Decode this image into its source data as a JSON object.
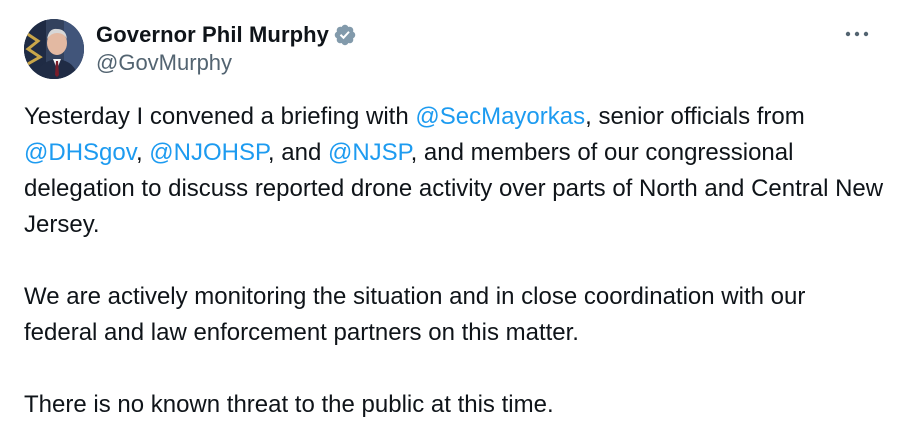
{
  "author": {
    "display_name": "Governor Phil Murphy",
    "handle": "@GovMurphy",
    "verified_icon": "verified-badge-icon",
    "avatar": "avatar-photo"
  },
  "menu": {
    "icon": "more-options-icon"
  },
  "colors": {
    "text": "#0f1419",
    "secondary_text": "#536471",
    "mention": "#1d9bf0",
    "verified_badge": "#829aab"
  },
  "tweet": {
    "p1": {
      "t1": "Yesterday I convened a briefing with ",
      "m1": "@SecMayorkas",
      "t2": ", senior officials from ",
      "m2": "@DHSgov",
      "t3": ", ",
      "m3": "@NJOHSP",
      "t4": ", and ",
      "m4": "@NJSP",
      "t5": ", and members of our congressional delegation to discuss reported drone activity over parts of North and Central New Jersey."
    },
    "p2": "We are actively monitoring the situation and in close coordination with our federal and law enforcement partners on this matter.",
    "p3": "There is no known threat to the public at this time."
  }
}
